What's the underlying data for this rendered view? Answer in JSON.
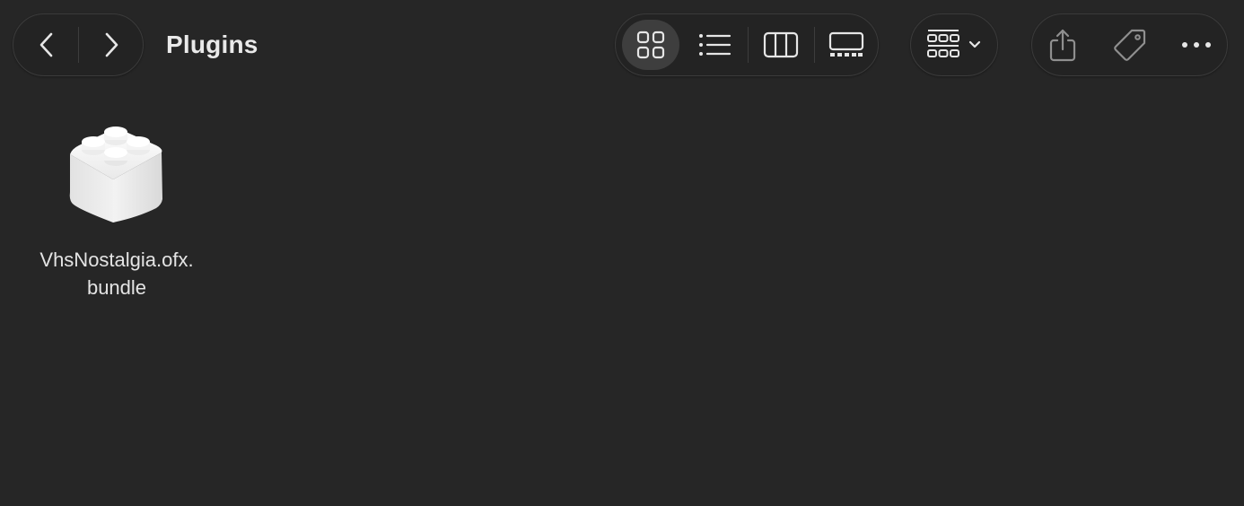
{
  "window": {
    "title": "Plugins"
  },
  "toolbar": {
    "nav": {
      "back_icon": "chevron-left-icon",
      "forward_icon": "chevron-right-icon"
    },
    "view_modes": [
      {
        "icon": "icon-view-grid-icon",
        "selected": true
      },
      {
        "icon": "list-view-icon",
        "selected": false
      },
      {
        "icon": "column-view-icon",
        "selected": false
      },
      {
        "icon": "gallery-view-icon",
        "selected": false
      }
    ],
    "group_icon": "group-by-grid-icon",
    "group_chevron_icon": "chevron-down-icon",
    "actions": [
      {
        "icon": "share-icon"
      },
      {
        "icon": "tag-icon"
      },
      {
        "icon": "more-icon"
      }
    ]
  },
  "files": [
    {
      "name_line1": "VhsNostalgia.ofx.",
      "name_line2": "bundle",
      "icon": "plugin-bundle-icon"
    }
  ],
  "colors": {
    "background": "#262626",
    "pill_background": "#232323",
    "pill_border": "#3b3b3b",
    "selected_background": "#3e3e3e",
    "text": "#e6e6e6"
  }
}
